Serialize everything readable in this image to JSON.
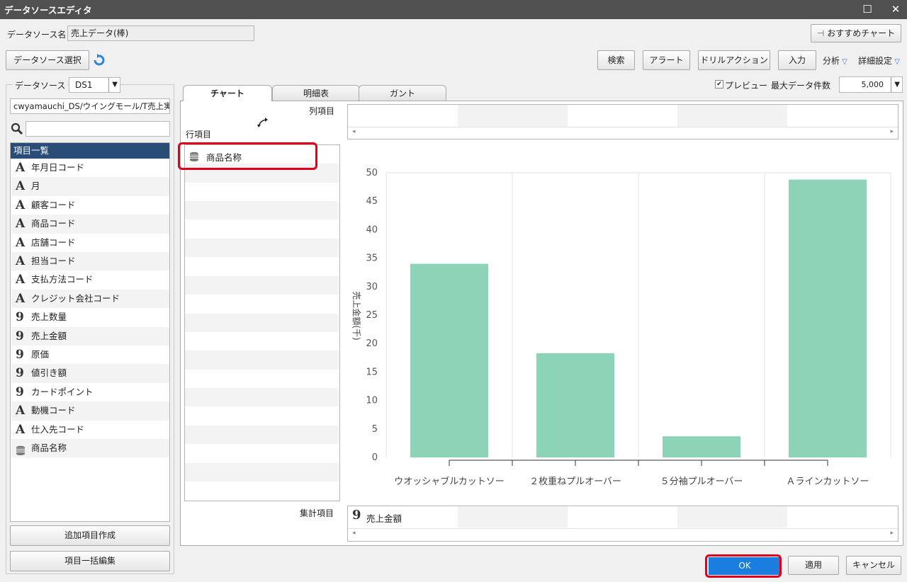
{
  "window": {
    "title": "データソースエディタ",
    "restore_glyph": "☐",
    "close_glyph": "✕"
  },
  "datasource_name": {
    "label": "データソース名",
    "value": "売上データ(棒)"
  },
  "recommend_chart_button": "おすすめチャート",
  "select_datasource_button": "データソース選択",
  "toolbar": {
    "search": "検索",
    "alert": "アラート",
    "drill": "ドリルアクション",
    "input": "入力",
    "analysis": "分析",
    "detail": "詳細設定"
  },
  "datasource": {
    "label": "データソース",
    "selected": "DS1",
    "path": "cwyamauchi_DS/ウイングモール/T売上実"
  },
  "item_list": {
    "header": "項目一覧",
    "items": [
      {
        "label": "年月日コード",
        "type": "text"
      },
      {
        "label": "月",
        "type": "text"
      },
      {
        "label": "顧客コード",
        "type": "text"
      },
      {
        "label": "商品コード",
        "type": "text"
      },
      {
        "label": "店舗コード",
        "type": "text"
      },
      {
        "label": "担当コード",
        "type": "text"
      },
      {
        "label": "支払方法コード",
        "type": "text"
      },
      {
        "label": "クレジット会社コード",
        "type": "text"
      },
      {
        "label": "売上数量",
        "type": "number"
      },
      {
        "label": "売上金額",
        "type": "number"
      },
      {
        "label": "原価",
        "type": "number"
      },
      {
        "label": "値引き額",
        "type": "number"
      },
      {
        "label": "カードポイント",
        "type": "number"
      },
      {
        "label": "動機コード",
        "type": "text"
      },
      {
        "label": "仕入先コード",
        "type": "text"
      },
      {
        "label": "商品名称",
        "type": "dimension"
      }
    ]
  },
  "add_item_button": "追加項目作成",
  "bulk_edit_button": "項目一括編集",
  "tabs": [
    {
      "label": "チャート",
      "active": true
    },
    {
      "label": "明細表",
      "active": false
    },
    {
      "label": "ガント",
      "active": false
    }
  ],
  "preview": {
    "label": "プレビュー",
    "checked": true,
    "check_glyph": "✔"
  },
  "max_rows": {
    "label": "最大データ件数",
    "value": "5,000"
  },
  "column_items_label": "列項目",
  "row_items_label": "行項目",
  "row_item": "商品名称",
  "aggregate_items_label": "集計項目",
  "aggregate_item": "売上金額",
  "icons": {
    "text_type": "A",
    "number_type": "9",
    "scroll_left": "◂",
    "scroll_right": "▸"
  },
  "buttons": {
    "ok": "OK",
    "apply": "適用",
    "cancel": "キャンセル"
  },
  "colors": {
    "bar": "#8dd3b8",
    "highlight": "#e0001b",
    "ok_button": "#1a7ee0",
    "header": "#2a4d78"
  },
  "chart_data": {
    "type": "bar",
    "categories": [
      "ウオッシャブルカットソー",
      "２枚重ねプルオーバー",
      "５分袖プルオーバー",
      "Ａラインカットソー"
    ],
    "values": [
      34,
      18.3,
      3.7,
      48.8
    ],
    "ylabel": "売上金額(千)",
    "ylim": [
      0,
      50
    ],
    "yticks": [
      0,
      5,
      10,
      15,
      20,
      25,
      30,
      35,
      40,
      45,
      50
    ],
    "grid": true
  }
}
